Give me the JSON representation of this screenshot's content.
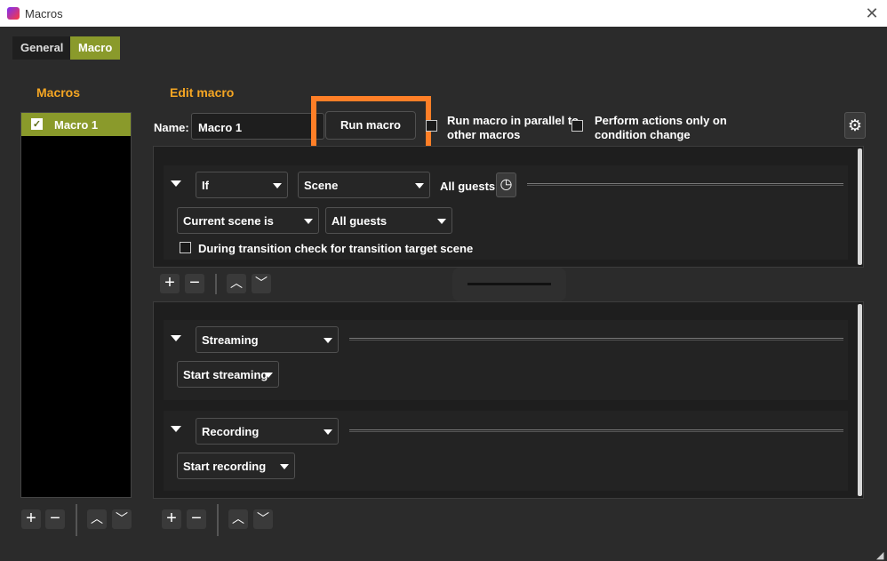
{
  "window": {
    "title": "Macros"
  },
  "tabs": [
    {
      "label": "General"
    },
    {
      "label": "Macro"
    }
  ],
  "sidebar": {
    "title": "Macros",
    "items": [
      {
        "label": "Macro 1",
        "checked": true
      }
    ]
  },
  "editor": {
    "title": "Edit macro",
    "name_label": "Name:",
    "name_value": "Macro 1",
    "run_button": "Run macro",
    "parallel_label": "Run macro in parallel to other macros",
    "parallel_line1": "Run macro in parallel to",
    "parallel_line2": "other macros",
    "change_label_line1": "Perform actions only on",
    "change_label_line2": "condition change"
  },
  "condition": {
    "logic": "If",
    "type": "Scene",
    "summary": "All guests",
    "scene_condition": "Current scene is",
    "scene": "All guests",
    "transition_check": "During transition check for transition target scene"
  },
  "actions": [
    {
      "type": "Streaming",
      "action": "Start streaming"
    },
    {
      "type": "Recording",
      "action": "Start recording"
    }
  ],
  "colors": {
    "accent": "#8a9a2b",
    "section_title": "#f5a623",
    "highlight": "#ff7f27"
  }
}
